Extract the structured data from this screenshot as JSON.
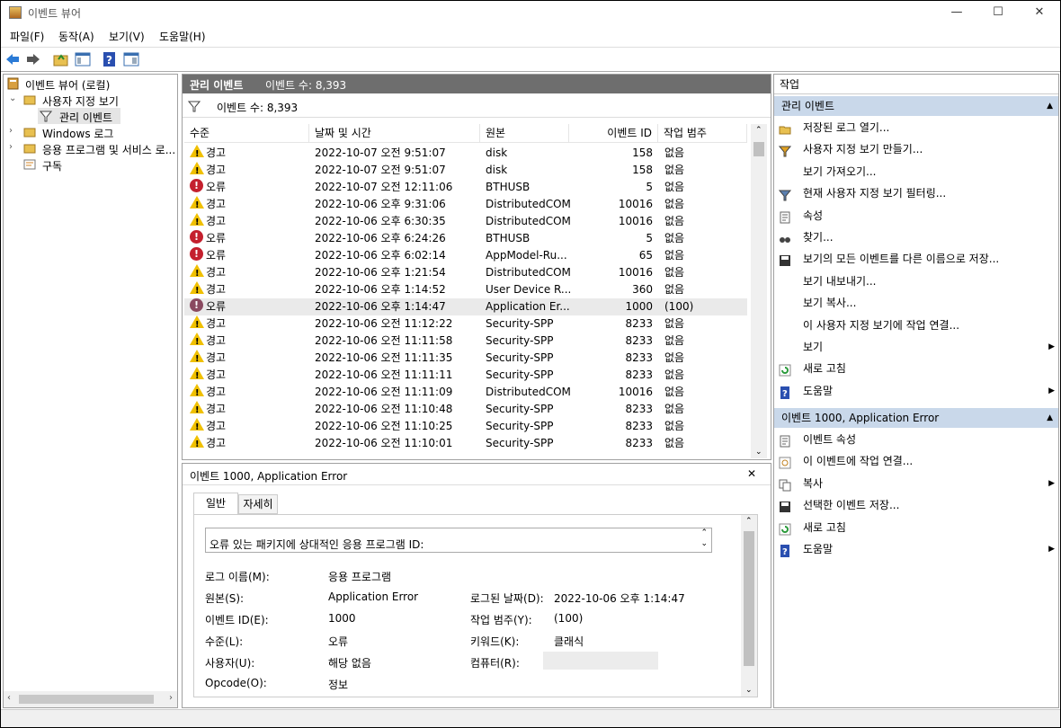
{
  "window": {
    "title": "이벤트 뷰어",
    "controls": {
      "min": "—",
      "max": "☐",
      "close": "✕"
    }
  },
  "menu": [
    "파일(F)",
    "동작(A)",
    "보기(V)",
    "도움말(H)"
  ],
  "tree": {
    "root": "이벤트 뷰어 (로컬)",
    "custom_views": "사용자 지정 보기",
    "admin_events": "관리 이벤트",
    "windows_logs": "Windows 로그",
    "apps_services": "응용 프로그램 및 서비스 로...",
    "subscriptions": "구독"
  },
  "center": {
    "header_title": "관리 이벤트",
    "header_count": "이벤트 수: 8,393",
    "filter_count": "이벤트 수: 8,393",
    "columns": [
      "수준",
      "날짜 및 시간",
      "원본",
      "이벤트 ID",
      "작업 범주"
    ],
    "rows": [
      {
        "level": "경고",
        "type": "warn",
        "date": "2022-10-07 오전 9:51:07",
        "source": "disk",
        "id": "158",
        "cat": "없음"
      },
      {
        "level": "경고",
        "type": "warn",
        "date": "2022-10-07 오전 9:51:07",
        "source": "disk",
        "id": "158",
        "cat": "없음"
      },
      {
        "level": "오류",
        "type": "err",
        "date": "2022-10-07 오전 12:11:06",
        "source": "BTHUSB",
        "id": "5",
        "cat": "없음"
      },
      {
        "level": "경고",
        "type": "warn",
        "date": "2022-10-06 오후 9:31:06",
        "source": "DistributedCOM",
        "id": "10016",
        "cat": "없음"
      },
      {
        "level": "경고",
        "type": "warn",
        "date": "2022-10-06 오후 6:30:35",
        "source": "DistributedCOM",
        "id": "10016",
        "cat": "없음"
      },
      {
        "level": "오류",
        "type": "err",
        "date": "2022-10-06 오후 6:24:26",
        "source": "BTHUSB",
        "id": "5",
        "cat": "없음"
      },
      {
        "level": "오류",
        "type": "err",
        "date": "2022-10-06 오후 6:02:14",
        "source": "AppModel-Ru...",
        "id": "65",
        "cat": "없음"
      },
      {
        "level": "경고",
        "type": "warn",
        "date": "2022-10-06 오후 1:21:54",
        "source": "DistributedCOM",
        "id": "10016",
        "cat": "없음"
      },
      {
        "level": "경고",
        "type": "warn",
        "date": "2022-10-06 오후 1:14:52",
        "source": "User Device R...",
        "id": "360",
        "cat": "없음"
      },
      {
        "level": "오류",
        "type": "err",
        "date": "2022-10-06 오후 1:14:47",
        "source": "Application Er...",
        "id": "1000",
        "cat": "(100)",
        "selected": true
      },
      {
        "level": "경고",
        "type": "warn",
        "date": "2022-10-06 오전 11:12:22",
        "source": "Security-SPP",
        "id": "8233",
        "cat": "없음"
      },
      {
        "level": "경고",
        "type": "warn",
        "date": "2022-10-06 오전 11:11:58",
        "source": "Security-SPP",
        "id": "8233",
        "cat": "없음"
      },
      {
        "level": "경고",
        "type": "warn",
        "date": "2022-10-06 오전 11:11:35",
        "source": "Security-SPP",
        "id": "8233",
        "cat": "없음"
      },
      {
        "level": "경고",
        "type": "warn",
        "date": "2022-10-06 오전 11:11:11",
        "source": "Security-SPP",
        "id": "8233",
        "cat": "없음"
      },
      {
        "level": "경고",
        "type": "warn",
        "date": "2022-10-06 오전 11:11:09",
        "source": "DistributedCOM",
        "id": "10016",
        "cat": "없음"
      },
      {
        "level": "경고",
        "type": "warn",
        "date": "2022-10-06 오전 11:10:48",
        "source": "Security-SPP",
        "id": "8233",
        "cat": "없음"
      },
      {
        "level": "경고",
        "type": "warn",
        "date": "2022-10-06 오전 11:10:25",
        "source": "Security-SPP",
        "id": "8233",
        "cat": "없음"
      },
      {
        "level": "경고",
        "type": "warn",
        "date": "2022-10-06 오전 11:10:01",
        "source": "Security-SPP",
        "id": "8233",
        "cat": "없음"
      }
    ]
  },
  "detail": {
    "title": "이벤트 1000, Application Error",
    "close": "✕",
    "tabs": [
      "일반",
      "자세히"
    ],
    "message": "오류 있는 패키지에 상대적인 응용 프로그램 ID:",
    "fields": {
      "log_name_label": "로그 이름(M):",
      "log_name": "응용 프로그램",
      "source_label": "원본(S):",
      "source": "Application Error",
      "logged_label": "로그된 날짜(D):",
      "logged": "2022-10-06 오후 1:14:47",
      "event_id_label": "이벤트 ID(E):",
      "event_id": "1000",
      "category_label": "작업 범주(Y):",
      "category": "(100)",
      "level_label": "수준(L):",
      "level": "오류",
      "keywords_label": "키워드(K):",
      "keywords": "클래식",
      "user_label": "사용자(U):",
      "user": "해당 없음",
      "computer_label": "컴퓨터(R):",
      "opcode_label": "Opcode(O):",
      "opcode": "정보"
    }
  },
  "actions": {
    "title": "작업",
    "section1": "관리 이벤트",
    "items1": [
      {
        "label": "저장된 로그 열기...",
        "icon": "folder-open-icon"
      },
      {
        "label": "사용자 지정 보기 만들기...",
        "icon": "filter-new-icon"
      },
      {
        "label": "보기 가져오기...",
        "icon": ""
      },
      {
        "label": "현재 사용자 지정 보기 필터링...",
        "icon": "filter-icon"
      },
      {
        "label": "속성",
        "icon": "properties-icon"
      },
      {
        "label": "찾기...",
        "icon": "find-icon"
      },
      {
        "label": "보기의 모든 이벤트를 다른 이름으로 저장...",
        "icon": "save-icon"
      },
      {
        "label": "보기 내보내기...",
        "icon": ""
      },
      {
        "label": "보기 복사...",
        "icon": ""
      },
      {
        "label": "이 사용자 지정 보기에 작업 연결...",
        "icon": ""
      },
      {
        "label": "보기",
        "icon": "",
        "submenu": true
      },
      {
        "label": "새로 고침",
        "icon": "refresh-icon"
      },
      {
        "label": "도움말",
        "icon": "help-icon",
        "submenu": true
      }
    ],
    "section2": "이벤트 1000, Application Error",
    "items2": [
      {
        "label": "이벤트 속성",
        "icon": "properties-icon"
      },
      {
        "label": "이 이벤트에 작업 연결...",
        "icon": "task-icon"
      },
      {
        "label": "복사",
        "icon": "copy-icon",
        "submenu": true
      },
      {
        "label": "선택한 이벤트 저장...",
        "icon": "save-icon"
      },
      {
        "label": "새로 고침",
        "icon": "refresh-icon"
      },
      {
        "label": "도움말",
        "icon": "help-icon",
        "submenu": true
      }
    ]
  }
}
